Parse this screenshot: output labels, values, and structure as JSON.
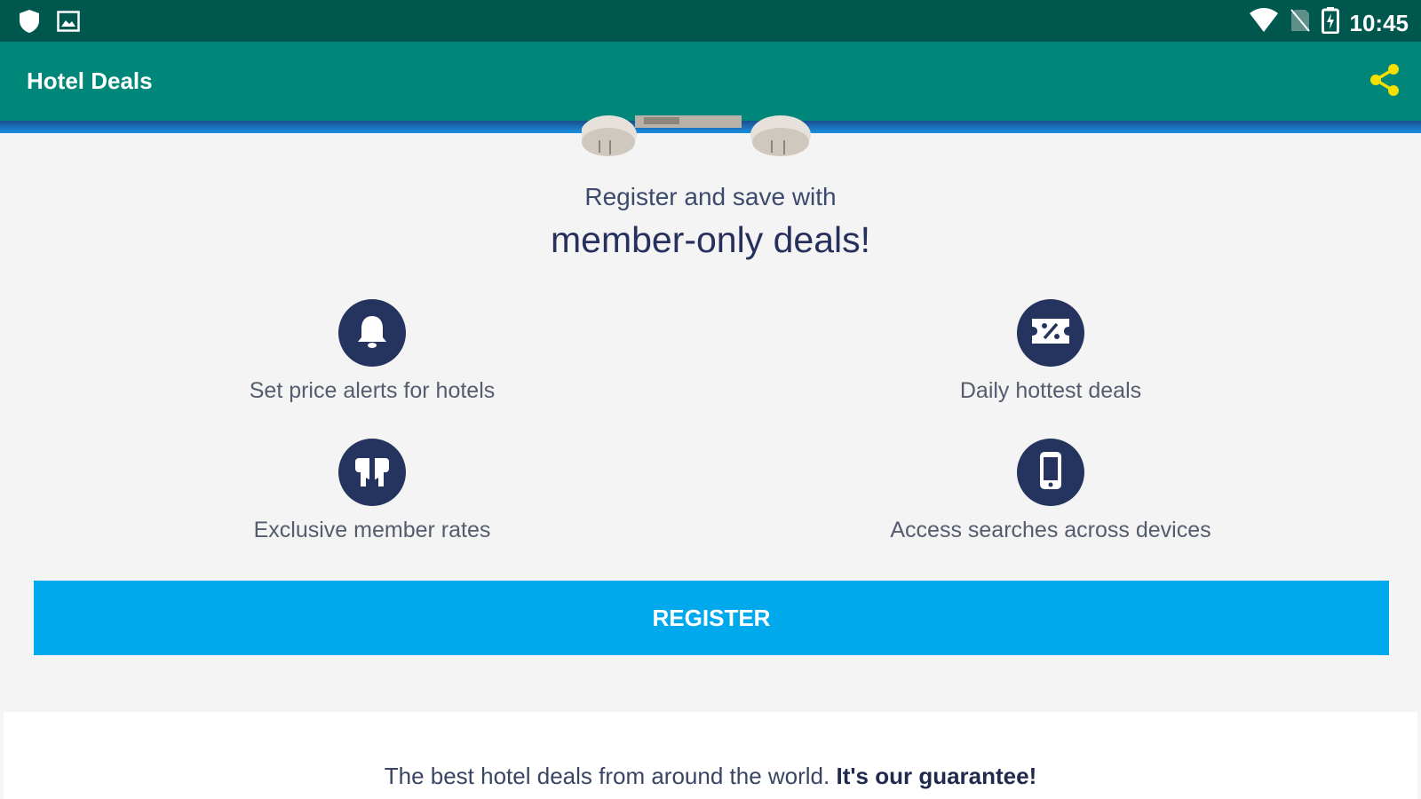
{
  "status_bar": {
    "time": "10:45",
    "left_icons": [
      "shield-icon",
      "image-icon"
    ],
    "right_icons": [
      "wifi-icon",
      "no-sim-icon",
      "battery-charging-icon"
    ]
  },
  "app_bar": {
    "title": "Hotel Deals",
    "share_icon": "share-icon"
  },
  "headline": {
    "sub": "Register and save with",
    "main": "member-only deals!"
  },
  "features": [
    {
      "icon": "bell-icon",
      "label": "Set price alerts for hotels"
    },
    {
      "icon": "ticket-percent-icon",
      "label": "Daily hottest deals"
    },
    {
      "icon": "gift-box-icon",
      "label": "Exclusive member rates"
    },
    {
      "icon": "phone-icon",
      "label": "Access searches across devices"
    }
  ],
  "register_label": "REGISTER",
  "guarantee": {
    "text": "The best hotel deals from around the world.",
    "strong": "It's our guarantee!"
  },
  "colors": {
    "status_bar": "#00574d",
    "app_bar": "#00877a",
    "accent_yellow": "#f5e000",
    "icon_navy": "#24345e",
    "register_blue": "#00a9ec"
  }
}
